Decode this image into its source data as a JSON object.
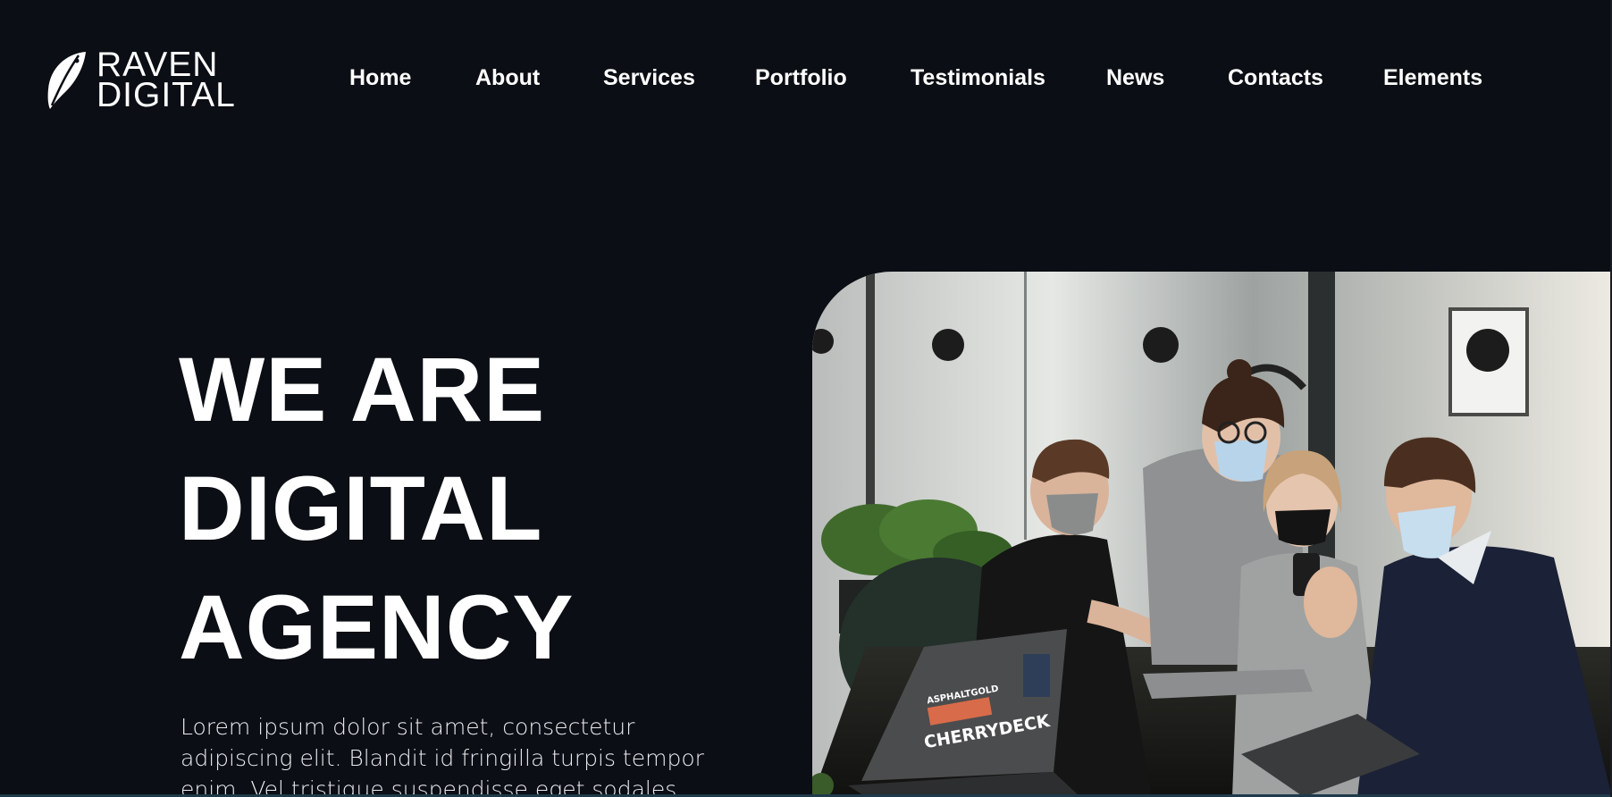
{
  "brand": {
    "line1": "RAVEN",
    "line2": "DIGITAL"
  },
  "nav": {
    "items": [
      "Home",
      "About",
      "Services",
      "Portfolio",
      "Testimonials",
      "News",
      "Contacts",
      "Elements"
    ]
  },
  "hero": {
    "title_lines": [
      "WE ARE",
      "DIGITAL",
      "AGENCY"
    ],
    "text": "Lorem ipsum dolor sit amet, consectetur adipiscing elit. Blandit id fringilla turpis tempor enim. Vel tristique suspendisse eget sodales egestas. Donec"
  },
  "photo": {
    "laptop_sticker_1": "ASPHALTGOLD",
    "laptop_sticker_2": "CHERRYDECK"
  },
  "colors": {
    "background": "#0b0e14",
    "text": "#ffffff",
    "accent_line": "#1f3a4a"
  }
}
